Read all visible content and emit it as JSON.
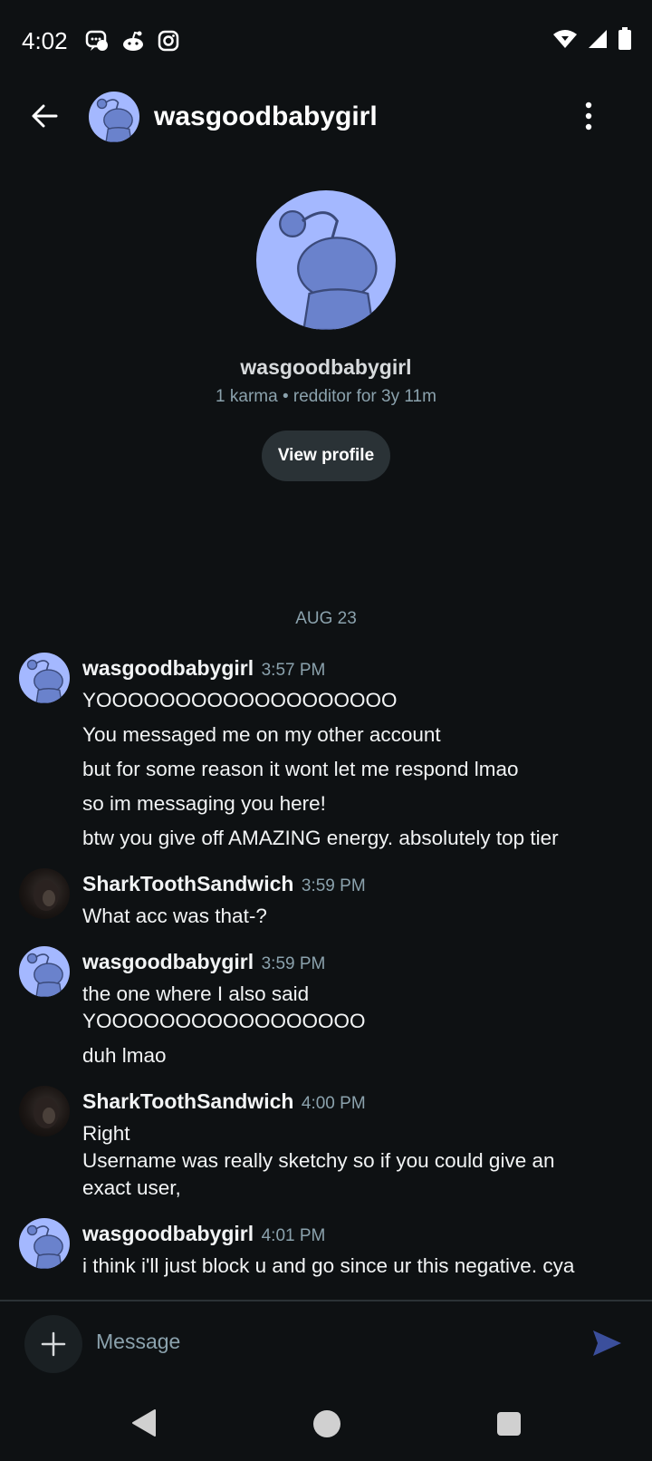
{
  "status_bar": {
    "time": "4:02",
    "left_icons": [
      "messenger-icon",
      "reddit-icon",
      "instagram-icon"
    ],
    "right_icons": [
      "wifi-icon",
      "signal-icon",
      "battery-icon"
    ]
  },
  "header": {
    "title": "wasgoodbabygirl"
  },
  "profile": {
    "name": "wasgoodbabygirl",
    "meta": "1 karma • redditor for 3y 11m",
    "button_label": "View profile"
  },
  "date_separator": "AUG 23",
  "messages": [
    {
      "author": "wasgoodbabygirl",
      "time": "3:57 PM",
      "avatar": "snoo",
      "lines": [
        "YOOOOOOOOOOOOOOOOOOO",
        "You messaged me on my other account",
        "but for some reason it wont let me respond lmao",
        "so im messaging you here!",
        "btw you give off AMAZING energy. absolutely top tier"
      ]
    },
    {
      "author": "SharkToothSandwich",
      "time": "3:59 PM",
      "avatar": "photo",
      "lines": [
        "What acc was that-?"
      ]
    },
    {
      "author": "wasgoodbabygirl",
      "time": "3:59 PM",
      "avatar": "snoo",
      "lines": [
        "the one where I also said",
        "YOOOOOOOOOOOOOOOOO",
        "duh lmao"
      ]
    },
    {
      "author": "SharkToothSandwich",
      "time": "4:00 PM",
      "avatar": "photo",
      "lines": [
        "Right",
        "Username was really sketchy so if you could give an",
        "exact user,"
      ]
    },
    {
      "author": "wasgoodbabygirl",
      "time": "4:01 PM",
      "avatar": "snoo",
      "lines": [
        "i think i'll just block u and go since ur this negative. cya"
      ]
    }
  ],
  "composer": {
    "placeholder": "Message"
  },
  "colors": {
    "background": "#0e1113",
    "snoo_avatar": "#a4b8ff",
    "meta_text": "#8ba2ad",
    "send_icon": "#3b4f9c"
  }
}
